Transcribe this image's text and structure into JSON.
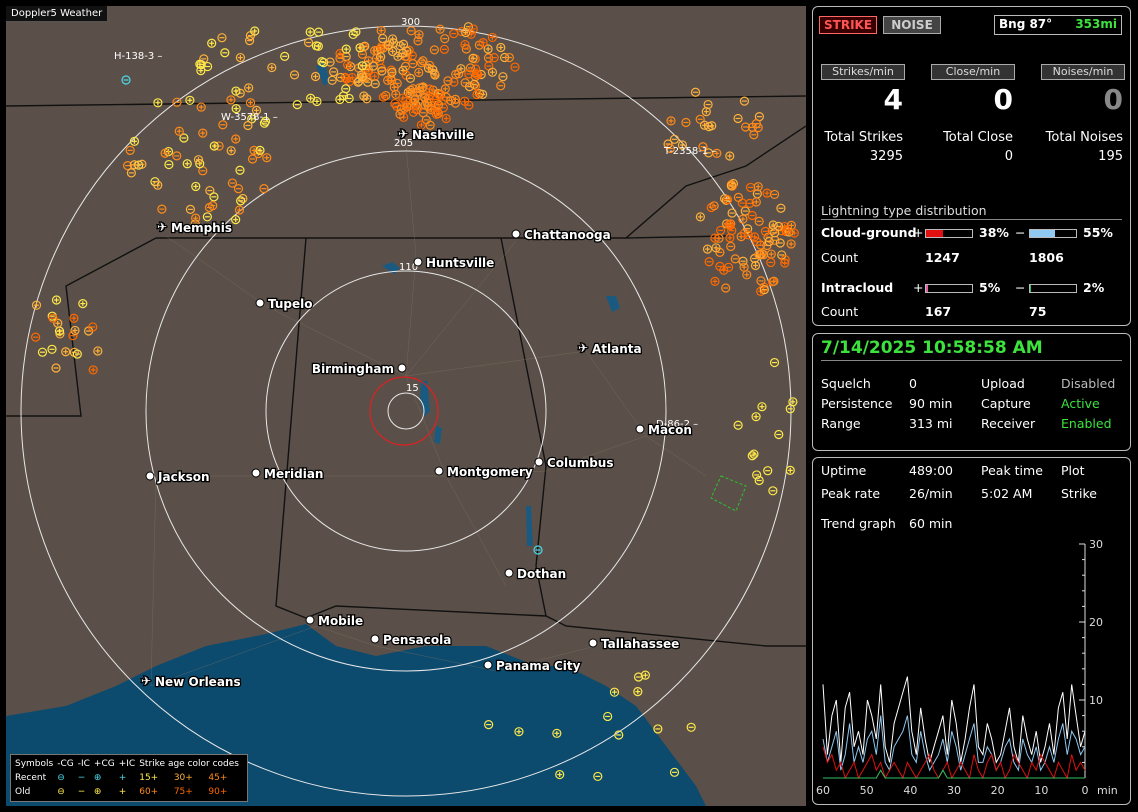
{
  "app": {
    "title": "Doppler5 Weather"
  },
  "map": {
    "cities": [
      {
        "name": "Nashville",
        "type": "airport"
      },
      {
        "name": "Memphis",
        "type": "airport"
      },
      {
        "name": "Chattanooga",
        "type": "dot"
      },
      {
        "name": "Huntsville",
        "type": "dot"
      },
      {
        "name": "Tupelo",
        "type": "dot"
      },
      {
        "name": "Atlanta",
        "type": "airport"
      },
      {
        "name": "Birmingham",
        "type": "dot"
      },
      {
        "name": "Macon",
        "type": "dot"
      },
      {
        "name": "Jackson",
        "type": "dot"
      },
      {
        "name": "Meridian",
        "type": "dot"
      },
      {
        "name": "Montgomery",
        "type": "dot"
      },
      {
        "name": "Columbus",
        "type": "dot"
      },
      {
        "name": "Dothan",
        "type": "dot"
      },
      {
        "name": "Mobile",
        "type": "dot"
      },
      {
        "name": "Pensacola",
        "type": "dot"
      },
      {
        "name": "Tallahassee",
        "type": "dot"
      },
      {
        "name": "Panama City",
        "type": "dot"
      },
      {
        "name": "New Orleans",
        "type": "airport"
      }
    ],
    "range_labels": [
      "300",
      "205",
      "110",
      "15"
    ],
    "storm_tags": [
      "H-138-3",
      "W-3578-1",
      "T-2358-1",
      "D-86-2"
    ]
  },
  "legend": {
    "symbols_label": "Symbols",
    "headers": [
      "-CG",
      "-IC",
      "+CG",
      "+IC"
    ],
    "age_title": "Strike age color codes",
    "recent_label": "Recent",
    "old_label": "Old",
    "recent_ages": [
      "15+",
      "30+",
      "45+"
    ],
    "old_ages": [
      "60+",
      "75+",
      "90+"
    ],
    "recent_symbols": [
      "⊖",
      "−",
      "⊕",
      "+"
    ],
    "old_symbols": [
      "⊖",
      "−",
      "⊕",
      "+"
    ]
  },
  "status": {
    "strike_button": "STRIKE",
    "noise_button": "NOISE",
    "bearing_label": "Bng 87°",
    "distance": "353mi",
    "strikes_per_min_label": "Strikes/min",
    "close_per_min_label": "Close/min",
    "noises_per_min_label": "Noises/min",
    "strikes_per_min": "4",
    "close_per_min": "0",
    "noises_per_min": "0",
    "total_strikes_label": "Total Strikes",
    "total_close_label": "Total Close",
    "total_noises_label": "Total Noises",
    "total_strikes": "3295",
    "total_close": "0",
    "total_noises": "195"
  },
  "distribution": {
    "title": "Lightning type distribution",
    "cloud_ground_label": "Cloud-ground",
    "intracloud_label": "Intracloud",
    "count_label": "Count",
    "plus": "+",
    "minus": "−",
    "cg_pos_pct": "38%",
    "cg_neg_pct": "55%",
    "cg_pos_count": "1247",
    "cg_neg_count": "1806",
    "ic_pos_pct": "5%",
    "ic_neg_pct": "2%",
    "ic_pos_count": "167",
    "ic_neg_count": "75",
    "cg_pos_frac": 0.38,
    "cg_neg_frac": 0.55,
    "ic_pos_frac": 0.05,
    "ic_neg_frac": 0.02,
    "colors": {
      "cg_pos": "#e01010",
      "cg_neg": "#8fc8f0",
      "ic_pos": "#e060a0",
      "ic_neg": "#30c060"
    }
  },
  "settings": {
    "datetime": "7/14/2025 10:58:58 AM",
    "squelch_label": "Squelch",
    "squelch": "0",
    "persistence_label": "Persistence",
    "persistence": "90 min",
    "range_label": "Range",
    "range": "313 mi",
    "upload_label": "Upload",
    "upload": "Disabled",
    "capture_label": "Capture",
    "capture": "Active",
    "receiver_label": "Receiver",
    "receiver": "Enabled"
  },
  "stats": {
    "uptime_label": "Uptime",
    "uptime": "489:00",
    "peak_time_label": "Peak time",
    "peak_time": "5:02 AM",
    "plot_label": "Plot",
    "plot": "Strike",
    "peak_rate_label": "Peak rate",
    "peak_rate": "26/min",
    "trend_label": "Trend graph",
    "trend": "60 min"
  },
  "chart_data": {
    "type": "line",
    "xlabel": "min",
    "x_ticks": [
      "60",
      "50",
      "40",
      "30",
      "20",
      "10",
      "0"
    ],
    "y_ticks": [
      "30",
      "20",
      "10"
    ],
    "ylim": [
      0,
      30
    ],
    "xlim": [
      60,
      0
    ],
    "series": [
      {
        "color": "#ffffff",
        "values": [
          12,
          3,
          8,
          10,
          2,
          9,
          11,
          4,
          6,
          3,
          10,
          8,
          5,
          12,
          4,
          2,
          7,
          9,
          11,
          13,
          6,
          3,
          9,
          5,
          2,
          4,
          6,
          8,
          3,
          10,
          7,
          2,
          5,
          9,
          12,
          4,
          3,
          7,
          5,
          2,
          3,
          6,
          9,
          4,
          2,
          8,
          5,
          3,
          6,
          2,
          4,
          7,
          3,
          9,
          11,
          5,
          12,
          8,
          4,
          6
        ]
      },
      {
        "color": "#8fc8f0",
        "values": [
          5,
          2,
          4,
          6,
          1,
          3,
          7,
          2,
          4,
          2,
          5,
          6,
          3,
          8,
          2,
          1,
          4,
          5,
          6,
          8,
          3,
          2,
          6,
          3,
          1,
          2,
          3,
          5,
          2,
          6,
          4,
          1,
          3,
          5,
          7,
          2,
          2,
          4,
          3,
          1,
          2,
          4,
          5,
          2,
          1,
          5,
          3,
          2,
          4,
          1,
          2,
          4,
          2,
          5,
          7,
          3,
          6,
          5,
          3,
          4
        ]
      },
      {
        "color": "#e01010",
        "values": [
          4,
          2,
          3,
          1,
          2,
          0,
          1,
          2,
          0,
          1,
          2,
          3,
          1,
          2,
          0,
          1,
          2,
          1,
          0,
          2,
          1,
          0,
          1,
          2,
          3,
          1,
          0,
          1,
          2,
          0,
          1,
          2,
          1,
          0,
          3,
          1,
          0,
          2,
          3,
          1,
          2,
          0,
          1,
          3,
          2,
          1,
          0,
          2,
          1,
          3,
          2,
          1,
          0,
          2,
          1,
          0,
          3,
          1,
          2,
          1
        ]
      },
      {
        "color": "#30c060",
        "values": [
          0,
          0,
          0,
          0,
          0,
          0,
          0,
          0,
          0,
          0,
          0,
          0,
          0,
          1,
          0,
          0,
          0,
          0,
          0,
          0,
          0,
          0,
          0,
          0,
          0,
          0,
          0,
          1,
          0,
          0,
          0,
          0,
          0,
          0,
          0,
          0,
          0,
          0,
          0,
          0,
          0,
          0,
          0,
          0,
          0,
          0,
          0,
          0,
          0,
          0,
          0,
          0,
          0,
          0,
          0,
          0,
          0,
          0,
          0,
          0
        ]
      }
    ]
  }
}
